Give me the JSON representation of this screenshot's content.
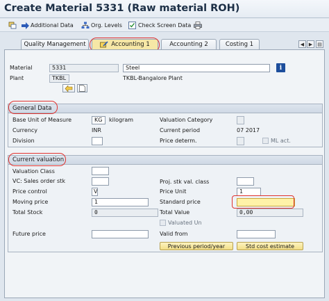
{
  "window": {
    "title": "Create Material 5331 (Raw material ROH)"
  },
  "toolbar": {
    "additional_data": "Additional Data",
    "org_levels": "Org. Levels",
    "check_screen_data": "Check Screen Data"
  },
  "tabs": [
    {
      "label": "Quality Management",
      "active": false
    },
    {
      "label": "Accounting 1",
      "active": true
    },
    {
      "label": "Accounting 2",
      "active": false
    },
    {
      "label": "Costing 1",
      "active": false
    }
  ],
  "header": {
    "material_label": "Material",
    "material_value": "5331",
    "material_desc": "Steel",
    "plant_label": "Plant",
    "plant_value": "TKBL",
    "plant_desc": "TKBL-Bangalore Plant"
  },
  "general_data": {
    "title": "General Data",
    "base_uom_label": "Base Unit of Measure",
    "base_uom_value": "KG",
    "base_uom_text": "kilogram",
    "valuation_category_label": "Valuation Category",
    "currency_label": "Currency",
    "currency_value": "INR",
    "current_period_label": "Current period",
    "current_period_value": "07 2017",
    "division_label": "Division",
    "price_determ_label": "Price determ.",
    "ml_act_label": "ML act."
  },
  "current_valuation": {
    "title": "Current valuation",
    "valuation_class_label": "Valuation Class",
    "vc_sales_order_label": "VC: Sales order stk",
    "proj_stk_label": "Proj. stk val. class",
    "price_control_label": "Price control",
    "price_control_value": "V",
    "price_unit_label": "Price Unit",
    "price_unit_value": "1",
    "moving_price_label": "Moving price",
    "moving_price_value": "1",
    "standard_price_label": "Standard price",
    "standard_price_value": "",
    "total_stock_label": "Total Stock",
    "total_stock_value": "0",
    "total_value_label": "Total Value",
    "total_value_value": "0,00",
    "valuated_un_label": "Valuated Un",
    "future_price_label": "Future price",
    "valid_from_label": "Valid from",
    "prev_period_button": "Previous period/year",
    "std_cost_button": "Std cost estimate"
  },
  "colors": {
    "accent_red": "#e0322f",
    "active_tab": "#f6e7a6",
    "title_text": "#1c2f46"
  }
}
